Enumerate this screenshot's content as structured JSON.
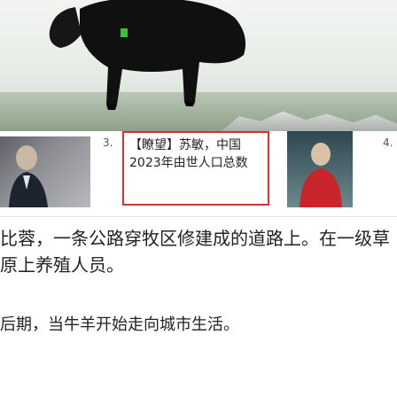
{
  "hero": {
    "image": "black-cattle-on-grass"
  },
  "related": {
    "items": [
      {
        "number": "3.",
        "title": "【瞭望】苏敏，中国2023年由世人口总数",
        "highlighted": true
      },
      {
        "number": "4.",
        "title": "",
        "highlighted": false
      }
    ]
  },
  "article": {
    "paragraph1": "比蓉，一条公路穿牧区修建成的道路上。在一级草原上养殖人员。",
    "paragraph2": "后期，当牛羊开始走向城市生活。"
  },
  "colors": {
    "accent": "#d8302e",
    "text": "#222222"
  }
}
